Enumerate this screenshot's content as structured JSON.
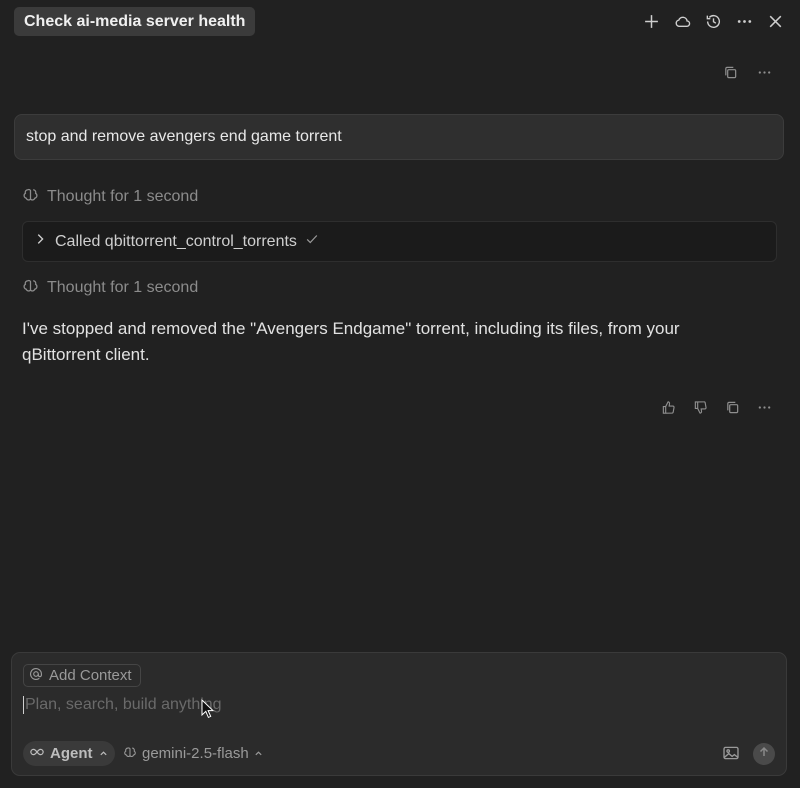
{
  "header": {
    "title": "Check ai-media server health",
    "icons": [
      "plus-icon",
      "cloud-icon",
      "history-icon",
      "more-icon",
      "close-icon"
    ]
  },
  "messages": {
    "user_prompt": "stop and remove avengers end game torrent",
    "thought_1": "Thought for 1 second",
    "tool_call_label": "Called qbittorrent_control_torrents",
    "thought_2": "Thought for 1 second",
    "answer_line_1": "I've stopped and removed the \"Avengers Endgame\" torrent, including its files, from your",
    "answer_line_2": "qBittorrent client."
  },
  "composer": {
    "add_context_label": "Add Context",
    "placeholder": "Plan, search, build anything",
    "mode_label": "Agent",
    "model_label": "gemini-2.5-flash"
  },
  "colors": {
    "background": "#212121",
    "panel": "#2b2b2b",
    "text": "#e2e2e2",
    "muted": "#8c8c8c"
  }
}
